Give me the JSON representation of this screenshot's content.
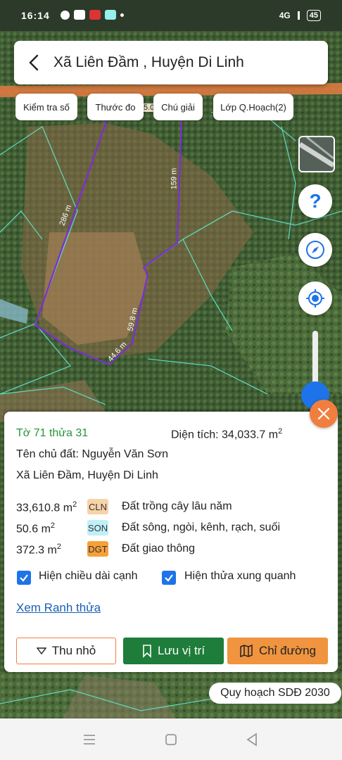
{
  "status_bar": {
    "time": "16:14",
    "signal": "4G",
    "battery": "45"
  },
  "header": {
    "title": "Xã Liên Đầm , Huyện Di Linh"
  },
  "toolbar": {
    "check_number_label": "Kiểm tra số",
    "measure_label": "Thước đo",
    "legend_label": "Chú giải",
    "plan_layer_label": "Lớp Q.Hoạch(2)"
  },
  "map": {
    "road_width_label": "5.0",
    "edge_labels": [
      "286 m",
      "159 m",
      "59.8 m",
      "44.6 m"
    ],
    "colors": {
      "parcel_outline": "#7b2fd6",
      "cadastral_lines": "#5fe0c8",
      "road": "#e8703a"
    }
  },
  "controls": {
    "help_icon": "question-icon",
    "compass_icon": "compass-icon",
    "locate_icon": "locate-icon"
  },
  "info": {
    "sheet_parcel": "Tờ 71 thửa 31",
    "area_label": "Diện tích: 34,033.7 m",
    "area_exp": "2",
    "owner": "Tên chủ đất: Nguyễn Văn Sơn",
    "location": "Xã Liên Đầm, Huyện Di Linh",
    "land_uses": [
      {
        "area": "33,610.8 m",
        "exp": "2",
        "code": "CLN",
        "color": "#f7d3a8",
        "desc": "Đất trồng cây lâu năm"
      },
      {
        "area": "50.6 m",
        "exp": "2",
        "code": "SON",
        "color": "#bff0f8",
        "desc": "Đất sông, ngòi, kênh, rạch, suối"
      },
      {
        "area": "372.3 m",
        "exp": "2",
        "code": "DGT",
        "color": "#f5a13a",
        "desc": "Đất giao thông"
      }
    ],
    "show_edge_lengths_label": "Hiện chiều dài cạnh",
    "show_neighbors_label": "Hiện thửa xung quanh",
    "show_edge_lengths": true,
    "show_neighbors": true,
    "view_boundary_link": "Xem Ranh thửa"
  },
  "actions": {
    "minimize": "Thu nhỏ",
    "save_location": "Lưu vị trí",
    "directions": "Chỉ đường"
  },
  "plan_badge": "Quy hoạch SDĐ 2030"
}
